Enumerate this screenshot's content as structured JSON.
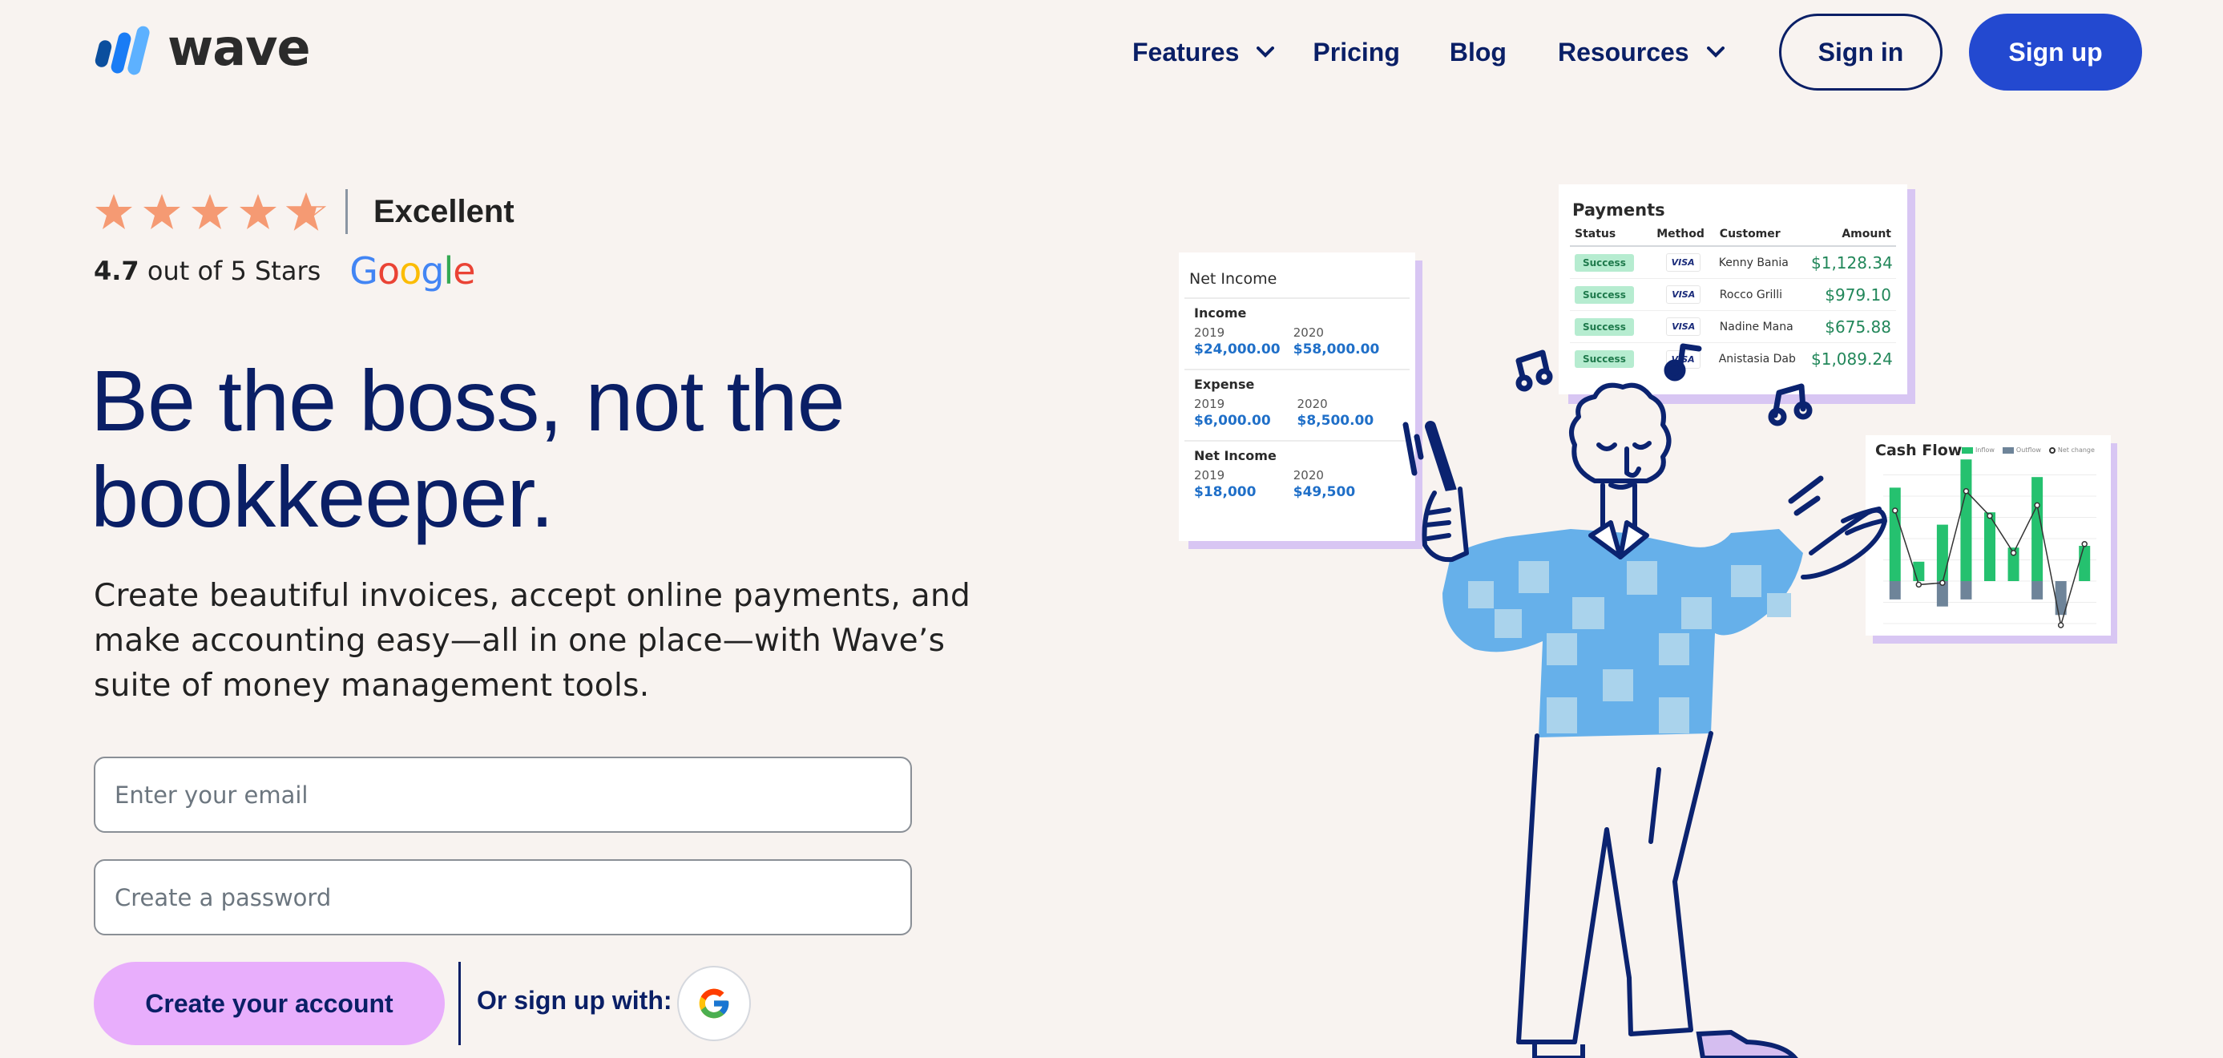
{
  "header": {
    "logo_text": "wave",
    "nav": [
      {
        "label": "Features",
        "has_dropdown": true
      },
      {
        "label": "Pricing",
        "has_dropdown": false
      },
      {
        "label": "Blog",
        "has_dropdown": false
      },
      {
        "label": "Resources",
        "has_dropdown": true
      }
    ],
    "sign_in_label": "Sign in",
    "sign_up_label": "Sign up"
  },
  "rating": {
    "stars_filled": 4.7,
    "stars_total": 5,
    "label": "Excellent",
    "score": "4.7",
    "score_suffix": " out of 5 Stars",
    "source": "Google"
  },
  "hero": {
    "headline": "Be the boss, not the bookkeeper.",
    "subtext": "Create beautiful invoices, accept online payments, and make accounting easy—all in one place—with Wave’s suite of money management tools."
  },
  "form": {
    "email_placeholder": "Enter your email",
    "email_value": "",
    "password_placeholder": "Create a password",
    "password_value": "",
    "create_button_label": "Create your account",
    "or_label": "Or sign up with:",
    "google_button": "google-icon"
  },
  "illustration": {
    "net_income_card": {
      "title": "Net Income",
      "sections": [
        {
          "title": "Income",
          "cols": [
            {
              "year": "2019",
              "value": "$24,000.00"
            },
            {
              "year": "2020",
              "value": "$58,000.00"
            }
          ]
        },
        {
          "title": "Expense",
          "cols": [
            {
              "year": "2019",
              "value": "$6,000.00"
            },
            {
              "year": "2020",
              "value": "$8,500.00"
            }
          ]
        },
        {
          "title": "Net Income",
          "cols": [
            {
              "year": "2019",
              "value": "$18,000"
            },
            {
              "year": "2020",
              "value": "$49,500"
            }
          ]
        }
      ]
    },
    "payments_card": {
      "title": "Payments",
      "headers": [
        "Status",
        "Method",
        "Customer",
        "Amount"
      ],
      "rows": [
        {
          "status": "Success",
          "method": "VISA",
          "customer": "Kenny Bania",
          "amount": "$1,128.34"
        },
        {
          "status": "Success",
          "method": "VISA",
          "customer": "Rocco Grilli",
          "amount": "$979.10"
        },
        {
          "status": "Success",
          "method": "VISA",
          "customer": "Nadine Mana",
          "amount": "$675.88"
        },
        {
          "status": "Success",
          "method": "VISA",
          "customer": "Anistasia Dab",
          "amount": "$1,089.24"
        }
      ]
    },
    "cash_flow_card": {
      "title": "Cash Flow",
      "legend": [
        "Inflow",
        "Outflow",
        "Net change"
      ],
      "inflow": [
        5.3,
        1.1,
        3.2,
        6.9,
        3.9,
        1.9,
        5.9,
        0,
        2.0
      ],
      "outflow": [
        -1.3,
        0,
        -1.8,
        -1.3,
        0,
        0,
        -1.3,
        -2.4,
        0
      ],
      "net_change": [
        4.0,
        -0.2,
        -0.1,
        5.1,
        3.7,
        1.6,
        4.3,
        -2.5,
        2.1
      ],
      "colors": {
        "inflow": "#25c16f",
        "outflow": "#6e8499",
        "net": "#333333"
      }
    }
  },
  "colors": {
    "background": "#f8f3f0",
    "navy": "#0a1f66",
    "primary": "#2349d0",
    "cta": "#e8aefc",
    "star": "#f59a73",
    "card_shadow": "#d8c6f3"
  }
}
